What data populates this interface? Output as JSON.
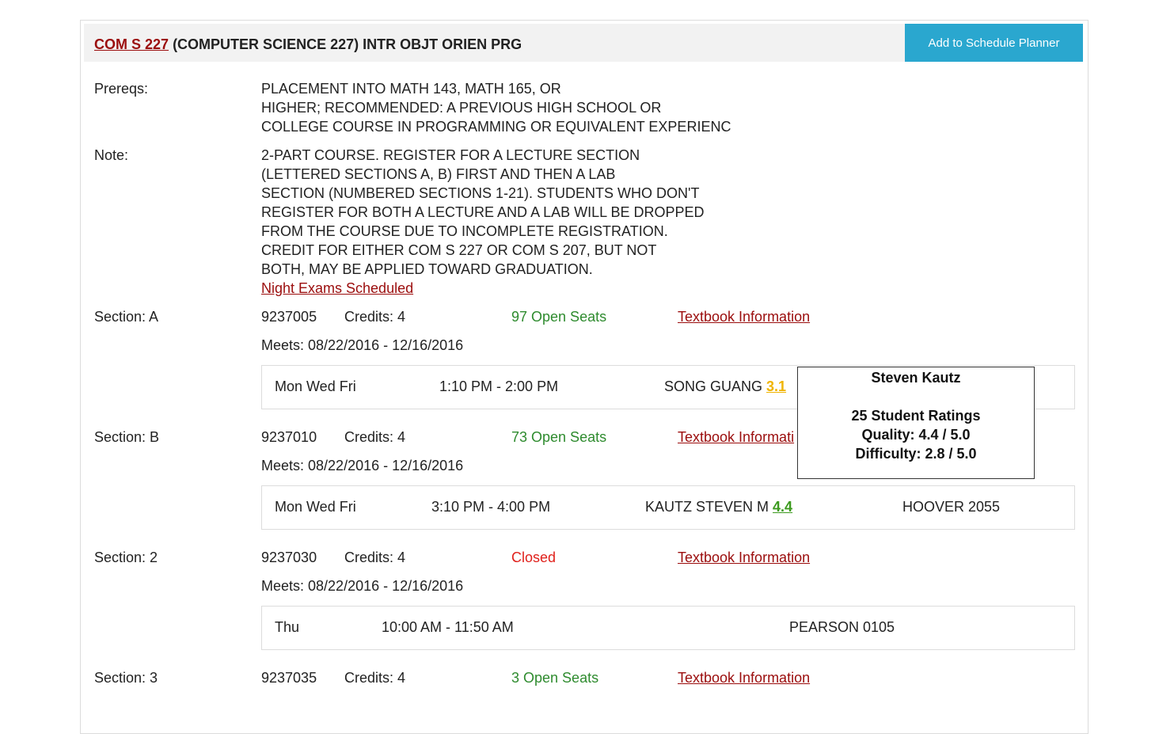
{
  "header": {
    "course_code": "COM S 227",
    "course_title": "(COMPUTER SCIENCE 227) INTR OBJT ORIEN PRG",
    "add_button": "Add to Schedule Planner"
  },
  "prereqs": {
    "label": "Prereqs:",
    "lines": [
      "PLACEMENT INTO MATH 143, MATH 165, OR",
      "HIGHER; RECOMMENDED: A PREVIOUS HIGH SCHOOL OR",
      "COLLEGE COURSE IN PROGRAMMING OR EQUIVALENT EXPERIENC"
    ]
  },
  "note": {
    "label": "Note:",
    "lines": [
      "2-PART COURSE. REGISTER FOR A LECTURE SECTION",
      "(LETTERED SECTIONS A, B) FIRST AND THEN A LAB",
      "SECTION (NUMBERED SECTIONS 1-21). STUDENTS WHO DON'T",
      "REGISTER FOR BOTH A LECTURE AND A LAB WILL BE DROPPED",
      "FROM THE COURSE DUE TO INCOMPLETE REGISTRATION.",
      "CREDIT FOR EITHER COM S 227 OR COM S 207, BUT NOT",
      "BOTH, MAY BE APPLIED TOWARD GRADUATION."
    ],
    "link": "Night Exams Scheduled"
  },
  "sections": [
    {
      "label": "Section: A",
      "id": "9237005",
      "credits": "Credits: 4",
      "seats": "97 Open Seats",
      "textbook": "Textbook Information",
      "meets": "Meets: 08/22/2016 - 12/16/2016",
      "days": "Mon Wed Fri",
      "time": "1:10 PM - 2:00 PM",
      "instructor": "SONG GUANG",
      "rating": "3.1",
      "room": ""
    },
    {
      "label": "Section: B",
      "id": "9237010",
      "credits": "Credits: 4",
      "seats": "73 Open Seats",
      "textbook": "Textbook Informati",
      "meets": "Meets: 08/22/2016 - 12/16/2016",
      "days": "Mon Wed Fri",
      "time": "3:10 PM - 4:00 PM",
      "instructor": "KAUTZ STEVEN M",
      "rating": "4.4",
      "room": "HOOVER 2055"
    },
    {
      "label": "Section: 2",
      "id": "9237030",
      "credits": "Credits: 4",
      "seats": "Closed",
      "textbook": "Textbook Information",
      "meets": "Meets: 08/22/2016 - 12/16/2016",
      "days": "Thu",
      "time": "10:00 AM - 11:50 AM",
      "instructor": "",
      "rating": "",
      "room": "PEARSON 0105"
    },
    {
      "label": "Section: 3",
      "id": "9237035",
      "credits": "Credits: 4",
      "seats": "3 Open Seats",
      "textbook": "Textbook Information"
    }
  ],
  "tooltip": {
    "name": "Steven Kautz",
    "ratings": "25 Student Ratings",
    "quality": "Quality: 4.4 / 5.0",
    "difficulty": "Difficulty: 2.8 / 5.0"
  },
  "colors": {
    "link": "#9b0d0d",
    "button": "#2aa7cf",
    "open": "#2e8b2e",
    "closed": "#e0201b",
    "rating_mid": "#f0b400",
    "rating_high": "#3c9a1e"
  }
}
